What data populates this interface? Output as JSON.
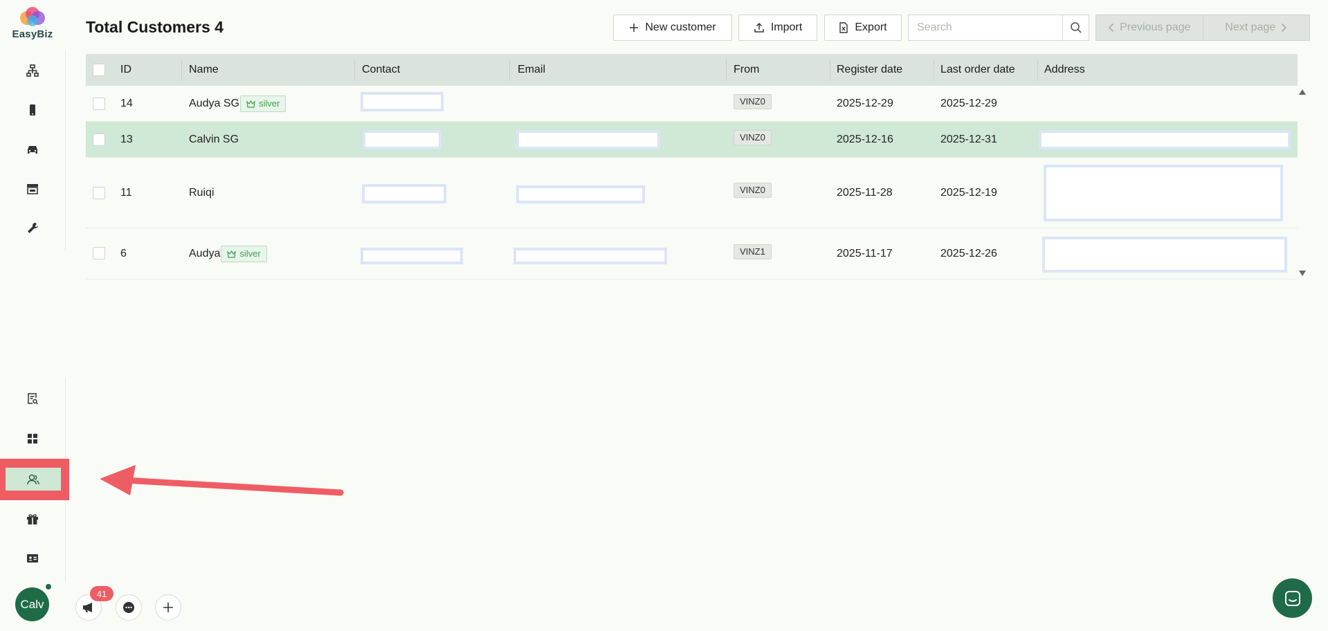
{
  "app": {
    "logo_text": "EasyBiz"
  },
  "header": {
    "title": "Total Customers 4",
    "new_customer": "New customer",
    "import": "Import",
    "export": "Export",
    "search_placeholder": "Search",
    "prev_page": "Previous page",
    "next_page": "Next page"
  },
  "table": {
    "columns": [
      "ID",
      "Name",
      "Contact",
      "Email",
      "From",
      "Register date",
      "Last order date",
      "Address"
    ],
    "rows": [
      {
        "id": "14",
        "name": "Audya SG",
        "tier": "silver",
        "from": "VINZ0",
        "register": "2025-12-29",
        "last_order": "2025-12-29"
      },
      {
        "id": "13",
        "name": "Calvin SG",
        "tier": "",
        "from": "VINZ0",
        "register": "2025-12-16",
        "last_order": "2025-12-31"
      },
      {
        "id": "11",
        "name": "Ruiqi",
        "tier": "",
        "from": "VINZ0",
        "register": "2025-11-28",
        "last_order": "2025-12-19"
      },
      {
        "id": "6",
        "name": "Audya",
        "tier": "silver",
        "from": "VINZ1",
        "register": "2025-11-17",
        "last_order": "2025-12-26"
      }
    ]
  },
  "sidebar": {
    "top_icons": [
      "org-chart-icon",
      "phone-icon",
      "car-icon",
      "store-icon",
      "wrench-icon"
    ],
    "bottom_icons": [
      "report-search-icon",
      "dashboard-icon",
      "customers-icon",
      "gift-icon",
      "id-card-icon"
    ],
    "active": "customers-icon"
  },
  "footer": {
    "avatar": "Calv",
    "notifications": "41"
  },
  "colors": {
    "brand": "#1f6b48",
    "selected_row": "#d0e8d6",
    "annotation": "#ef5d64"
  }
}
